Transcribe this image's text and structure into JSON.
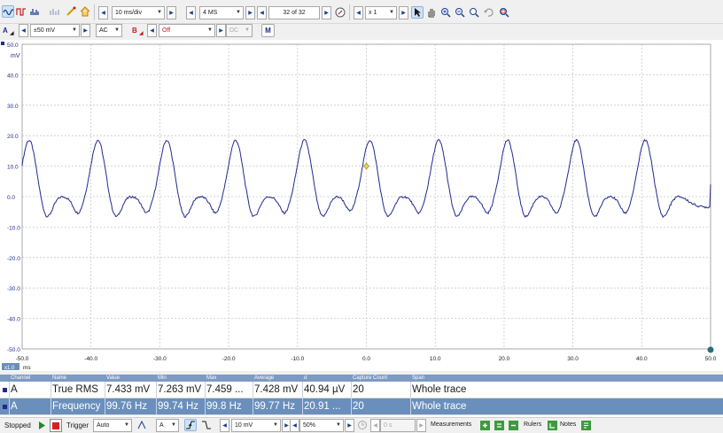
{
  "toolbar": {
    "timebase": "10 ms/div",
    "samples": "4 MS",
    "capture": "32 of 32",
    "zoom": "x 1"
  },
  "channel_bar": {
    "channel_a_label": "A",
    "channel_a_range": "±50 mV",
    "channel_a_coupling": "AC",
    "channel_b_label": "B",
    "channel_b_range": "Off",
    "channel_b_coupling": "DC",
    "math_label": "M"
  },
  "chart_data": {
    "type": "line",
    "ylabel": "mV",
    "xlabel": "ms",
    "x_range": [
      -50,
      50
    ],
    "ylim": [
      -50,
      50
    ],
    "y_ticks": [
      "50.0",
      "40.0",
      "30.0",
      "20.0",
      "10.0",
      "0.0",
      "-10.0",
      "-20.0",
      "-30.0",
      "-40.0",
      "-50.0"
    ],
    "x_ticks": [
      "-50.0",
      "-40.0",
      "-30.0",
      "-20.0",
      "-10.0",
      "0.0",
      "10.0",
      "20.0",
      "30.0",
      "40.0",
      "50.0"
    ],
    "x_unit_badge": "x1.0",
    "series": [
      {
        "color": "#1f2b8c",
        "frequency_hz": 99.76,
        "peak_mv": 18.5,
        "trough_mv": -8.5,
        "baseline_mv": -3.5,
        "peak_times_ms": [
          -49,
          -39,
          -29,
          -19,
          -9,
          0.5,
          10.5,
          20.5,
          30.5,
          40.5
        ]
      }
    ],
    "trigger_marker": {
      "x": 0,
      "y": 10,
      "color": "#e8d64a"
    },
    "grid": true
  },
  "measurements": {
    "headers": [
      "Channel",
      "Name",
      "Value",
      "Min",
      "Max",
      "Average",
      "σ",
      "Capture Count",
      "Span"
    ],
    "rows": [
      [
        "A",
        "True RMS",
        "7.433 mV",
        "7.263 mV",
        "7.459 ...",
        "7.428 mV",
        "40.94 µV",
        "20",
        "Whole trace"
      ],
      [
        "A",
        "Frequency",
        "99.76 Hz",
        "99.74 Hz",
        "99.8 Hz",
        "99.77 Hz",
        "20.91 ...",
        "20",
        "Whole trace"
      ]
    ]
  },
  "statusbar": {
    "status": "Stopped",
    "trigger_label": "Trigger",
    "trigger_mode": "Auto",
    "trigger_channel": "A",
    "threshold": "10 mV",
    "pretrigger": "50%",
    "delay": "0 s",
    "measurements_label": "Measurements",
    "rulers_label": "Rulers",
    "notes_label": "Notes"
  },
  "colors": {
    "accent": "#1f2b8c",
    "header_bg": "#7d9ac4",
    "selected_row": "#6a8fbd",
    "stop_red": "#d92020",
    "channel_b_red": "#c02020",
    "marker_green": "#2a8c5a"
  }
}
